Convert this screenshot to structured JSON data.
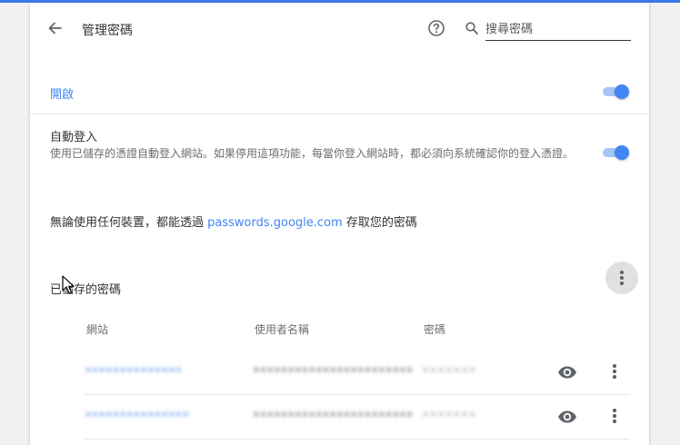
{
  "header": {
    "title": "管理密碼",
    "search_placeholder": "搜尋密碼"
  },
  "offer_to_save": {
    "label": "開啟",
    "enabled": true
  },
  "auto_signin": {
    "title": "自動登入",
    "description": "使用已儲存的憑證自動登入網站。如果停用這項功能，每當你登入網站時，都必須向系統確認你的登入憑證。",
    "enabled": true
  },
  "passwords_note": {
    "prefix": "無論使用任何裝置，都能透過 ",
    "link": "passwords.google.com",
    "suffix": " 存取您的密碼"
  },
  "saved_passwords": {
    "title": "已儲存的密碼",
    "columns": [
      "網站",
      "使用者名稱",
      "密碼"
    ],
    "rows": [
      {
        "site": "••••••••••••••",
        "username": "•••••••••••••••••••••••",
        "password": "•••••••"
      },
      {
        "site": "•••••••••••••••",
        "username": "•••••••••••••••••••••••",
        "password": "•••••••"
      }
    ]
  },
  "colors": {
    "accent": "#4285f4",
    "top_bar": "#3b78e7"
  }
}
